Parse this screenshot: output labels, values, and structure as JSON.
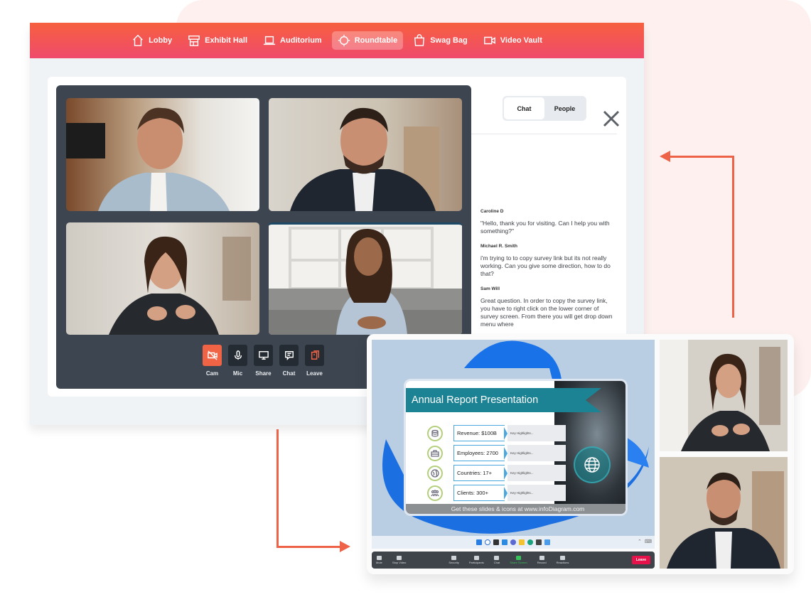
{
  "nav": {
    "items": [
      {
        "label": "Lobby",
        "icon": "home-icon",
        "active": false
      },
      {
        "label": "Exhibit Hall",
        "icon": "storefront-icon",
        "active": false
      },
      {
        "label": "Auditorium",
        "icon": "laptop-icon",
        "active": false
      },
      {
        "label": "Roundtable",
        "icon": "roundtable-icon",
        "active": true
      },
      {
        "label": "Swag Bag",
        "icon": "bag-icon",
        "active": false
      },
      {
        "label": "Video Vault",
        "icon": "video-icon",
        "active": false
      }
    ]
  },
  "roundtable": {
    "controls": [
      {
        "label": "Cam",
        "icon": "camera-off-icon",
        "state": "off"
      },
      {
        "label": "Mic",
        "icon": "microphone-icon"
      },
      {
        "label": "Share",
        "icon": "monitor-icon"
      },
      {
        "label": "Chat",
        "icon": "chat-icon"
      },
      {
        "label": "Leave",
        "icon": "leave-icon"
      }
    ],
    "participants": [
      "participant-1",
      "participant-2",
      "participant-3",
      "participant-4"
    ]
  },
  "sidebar": {
    "tabs": [
      {
        "label": "Chat",
        "active": true
      },
      {
        "label": "People",
        "active": false
      }
    ],
    "messages": [
      {
        "author": "Caroline D",
        "text": "\"Hello, thank you for visiting. Can I help you with something?\""
      },
      {
        "author": "Michael R. Smith",
        "text": "i'm trying to to copy survey link but its not really working. Can you give some direction, how to do that?"
      },
      {
        "author": "Sam Will",
        "text": "Great question. In order to copy the survey link, you have to right click on the lower corner of survey screen. From there you will get drop down menu where"
      }
    ]
  },
  "zoom_call": {
    "slide": {
      "title": "Annual Report Presentation",
      "rows": [
        {
          "label": "Revenue: $100B",
          "highlight": "Key Highlights..."
        },
        {
          "label": "Employees: 2700",
          "highlight": "Key Highlights..."
        },
        {
          "label": "Countries: 17+",
          "highlight": "Key Highlights..."
        },
        {
          "label": "Clients: 300+",
          "highlight": "Key Highlights..."
        }
      ],
      "footer": "Get these slides & icons at www.infoDiagram.com"
    },
    "toolbar": {
      "items": [
        {
          "label": "Mute"
        },
        {
          "label": "Stop Video"
        },
        {
          "label": "Security"
        },
        {
          "label": "Participants"
        },
        {
          "label": "Chat"
        },
        {
          "label": "Share Screen",
          "highlight": true
        },
        {
          "label": "Record"
        },
        {
          "label": "Reactions"
        }
      ],
      "leave_label": "Leave"
    }
  },
  "colors": {
    "accent": "#ee6248",
    "nav_gradient_top": "#f7603f",
    "nav_gradient_bottom": "#ef4a6c",
    "panel_dark": "#3d4550",
    "slide_teal": "#1b8394",
    "zoom_leave": "#e8124a",
    "share_green": "#38c05a"
  }
}
